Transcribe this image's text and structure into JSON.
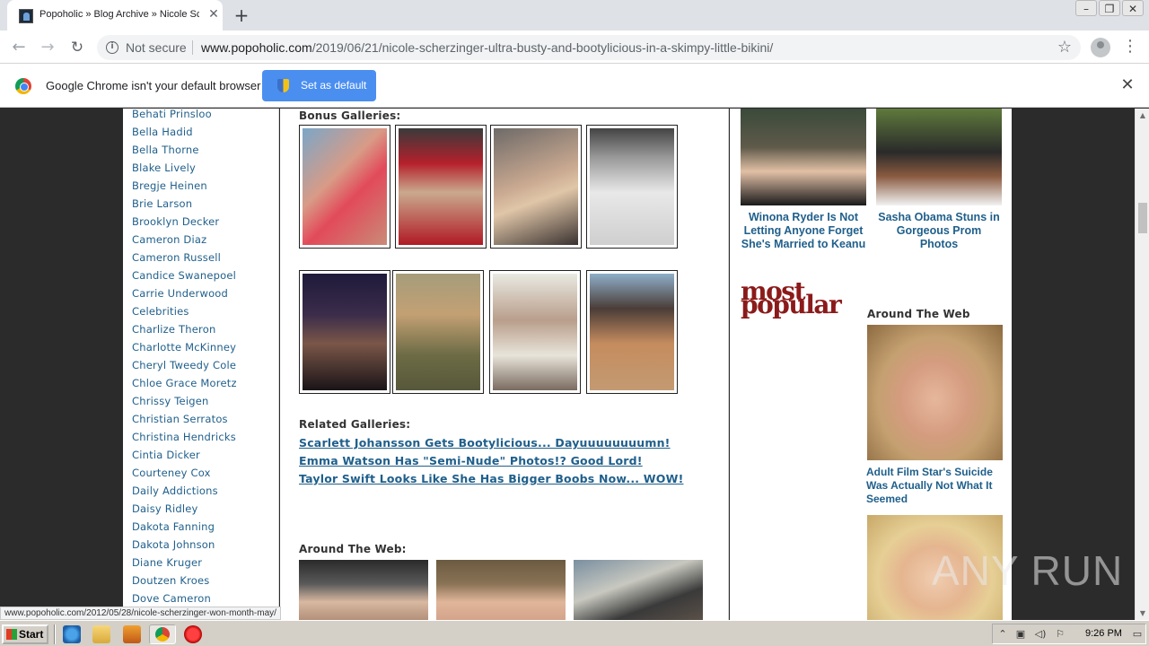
{
  "browser": {
    "tab_title": "Popoholic » Blog Archive » Nicole Scherzinger Ultra Busty",
    "new_tab_symbol": "+",
    "not_secure_label": "Not secure",
    "url_host": "www.popoholic.com",
    "url_path": "/2019/06/21/nicole-scherzinger-ultra-busty-and-bootylicious-in-a-skimpy-little-bikini/"
  },
  "infobar": {
    "message": "Google Chrome isn't your default browser",
    "button_label": "Set as default"
  },
  "sidebar": {
    "categories": [
      "Behati Prinsloo",
      "Bella Hadid",
      "Bella Thorne",
      "Blake Lively",
      "Bregje Heinen",
      "Brie Larson",
      "Brooklyn Decker",
      "Cameron Diaz",
      "Cameron Russell",
      "Candice Swanepoel",
      "Carrie Underwood",
      "Celebrities",
      "Charlize Theron",
      "Charlotte McKinney",
      "Cheryl Tweedy Cole",
      "Chloe Grace Moretz",
      "Chrissy Teigen",
      "Christian Serratos",
      "Christina Hendricks",
      "Cintia Dicker",
      "Courteney Cox",
      "Daily Addictions",
      "Daisy Ridley",
      "Dakota Fanning",
      "Dakota Johnson",
      "Diane Kruger",
      "Doutzen Kroes",
      "Dove Cameron"
    ]
  },
  "main": {
    "bonus_heading": "Bonus Galleries:",
    "related_heading": "Related Galleries:",
    "related_links": [
      "Scarlett Johansson Gets Bootylicious... Dayuuuuuuuumn!",
      "Emma Watson Has \"Semi-Nude\" Photos!? Good Lord!",
      "Taylor Swift Looks Like She Has Bigger Boobs Now... WOW!"
    ],
    "around_heading": "Around The Web:"
  },
  "right": {
    "captions": [
      "Winona Ryder Is Not Letting Anyone Forget She's Married to Keanu",
      "Sasha Obama Stuns in Gorgeous Prom Photos"
    ],
    "logo_line1": "most",
    "logo_line2": "popular",
    "around_heading": "Around The Web",
    "ad_caption": "Adult Film Star's Suicide Was Actually Not What It Seemed"
  },
  "status_url": "www.popoholic.com/2012/05/28/nicole-scherzinger-won-month-may/",
  "watermark": "ANY RUN",
  "taskbar": {
    "start_label": "Start",
    "clock": "9:26 PM"
  }
}
